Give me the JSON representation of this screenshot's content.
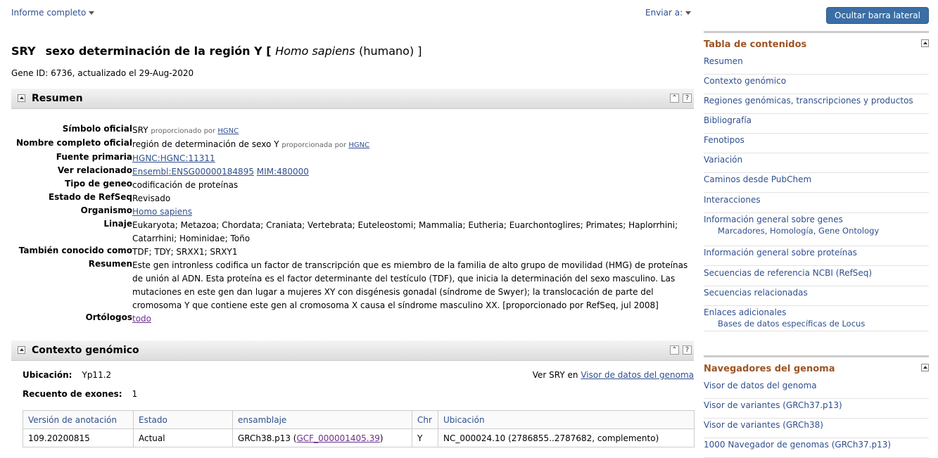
{
  "topbar": {
    "report_menu": "Informe completo",
    "send_menu": "Enviar a:",
    "hide_sidebar": "Ocultar barra lateral >>"
  },
  "title": {
    "symbol": "SRY",
    "name": "sexo determinación de la región Y [",
    "species": "Homo sapiens",
    "common": "(humano) ]"
  },
  "gene_info": "Gene ID: 6736, actualizado el 29-Aug-2020",
  "summary": {
    "section_title": "Resumen",
    "fields": {
      "official_symbol_label": "Símbolo oficial",
      "official_symbol": "SRY",
      "provided_by": "proporcionado por",
      "provided_by_f": "proporcionada por",
      "hgnc": "HGNC",
      "full_name_label": "Nombre completo oficial",
      "full_name": "región de determinación de sexo Y",
      "primary_source_label": "Fuente primaria",
      "primary_source": "HGNC:HGNC:11311",
      "see_related_label": "Ver relacionado",
      "ensembl": "Ensembl:ENSG00000184895",
      "mim": "MIM:480000",
      "gene_type_label": "Tipo de geneo",
      "gene_type": "codificación de proteínas",
      "refseq_status_label": "Estado de RefSeq",
      "refseq_status": "Revisado",
      "organism_label": "Organismo",
      "organism": "Homo sapiens",
      "lineage_label": "Linaje",
      "lineage": "Eukaryota; Metazoa; Chordata; Craniata; Vertebrata; Euteleostomi; Mammalia; Eutheria; Euarchontoglires; Primates; Haplorrhini; Catarrhini; Hominidae; Toño",
      "aka_label": "También conocido como",
      "aka": "TDF; TDY; SRXX1; SRXY1",
      "summary_label": "Resumen",
      "summary_text": "Este gen intronless codifica un factor de transcripción que es miembro de la familia de alto grupo de movilidad (HMG) de proteínas de unión al ADN. Esta proteína es el factor determinante del testículo (TDF), que inicia la determinación del sexo masculino. Las mutaciones en este gen dan lugar a mujeres XY con disgénesis gonadal (síndrome de Swyer); la translocación de parte del cromosoma Y que contiene este gen al cromosoma X causa el síndrome masculino XX. [proporcionado por RefSeq, jul 2008]",
      "orthologs_label": "Ortólogos",
      "orthologs": "todo"
    }
  },
  "genomic_context": {
    "section_title": "Contexto genómico",
    "location_label": "Ubicación:",
    "location": "Yp11.2",
    "exon_label": "Recuento de exones:",
    "exon_count": "1",
    "view_prefix": "Ver SRY en",
    "view_link": "Visor de datos del genoma",
    "table": {
      "headers": [
        "Versión de anotación",
        "Estado",
        "ensamblaje",
        "Chr",
        "Ubicación"
      ],
      "rows": [
        {
          "annotation": "109.20200815",
          "status": "Actual",
          "assembly": "GRCh38.p13 (",
          "assembly_link": "GCF_000001405.39",
          "assembly_end": ")",
          "chr": "Y",
          "location": "NC_000024.10 (2786855..2787682, complemento)"
        }
      ]
    }
  },
  "sidebar": {
    "toc_title": "Tabla de contenidos",
    "toc": [
      {
        "label": "Resumen"
      },
      {
        "label": "Contexto genómico"
      },
      {
        "label": "Regiones genómicas, transcripciones y productos"
      },
      {
        "label": "Bibliografía"
      },
      {
        "label": "Fenotipos"
      },
      {
        "label": "Variación"
      },
      {
        "label": "Caminos desde PubChem"
      },
      {
        "label": "Interacciones"
      },
      {
        "label": "Información general sobre genes",
        "subs": [
          "Marcadores",
          "Homología",
          "Gene Ontology"
        ]
      },
      {
        "label": "Información general sobre proteínas"
      },
      {
        "label": "Secuencias de referencia NCBI (RefSeq)"
      },
      {
        "label": "Secuencias relacionadas"
      },
      {
        "label": "Enlaces adicionales",
        "subs": [
          "Bases de datos específicas de Locus"
        ]
      }
    ],
    "browsers_title": "Navegadores del genoma",
    "browsers": [
      "Visor de datos del genoma",
      "Visor de variantes (GRCh37.p13)",
      "Visor de variantes (GRCh38)",
      "1000 Navegador de genomas (GRCh37.p13)"
    ]
  }
}
